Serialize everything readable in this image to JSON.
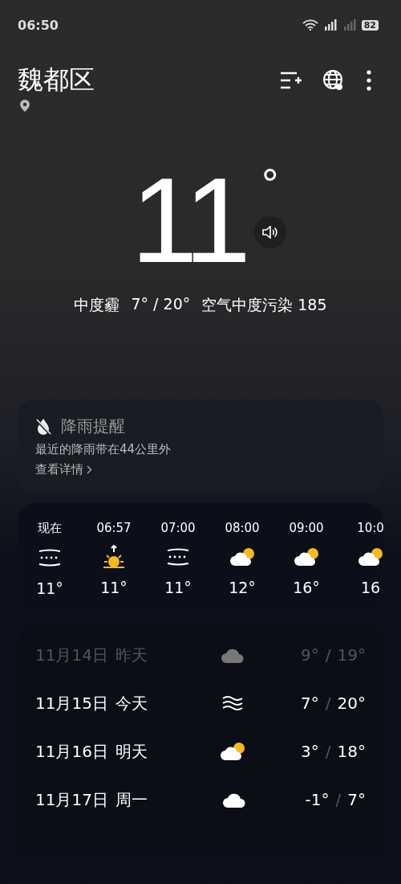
{
  "status_bar": {
    "time": "06:50",
    "battery": "82"
  },
  "header": {
    "location": "魏都区"
  },
  "current": {
    "temperature": "11",
    "degree": "°",
    "condition": "中度霾",
    "range": "7° / 20°",
    "air": "空气中度污染 185"
  },
  "rain_card": {
    "title": "降雨提醒",
    "text": "最近的降雨带在44公里外",
    "link": "查看详情"
  },
  "hourly": [
    {
      "time": "现在",
      "kind": "fog",
      "temp": "11°"
    },
    {
      "time": "06:57",
      "kind": "sunrise",
      "temp": "11°"
    },
    {
      "time": "07:00",
      "kind": "fog",
      "temp": "11°"
    },
    {
      "time": "08:00",
      "kind": "partly-cloudy",
      "temp": "12°"
    },
    {
      "time": "09:00",
      "kind": "partly-cloudy",
      "temp": "16°"
    },
    {
      "time": "10:0",
      "kind": "partly-cloudy",
      "temp": "16"
    }
  ],
  "daily": [
    {
      "date": "11月14日",
      "day": "昨天",
      "kind": "cloudy",
      "low": "9°",
      "separator": "/",
      "high": "19°",
      "past": true
    },
    {
      "date": "11月15日",
      "day": "今天",
      "kind": "haze",
      "low": "7°",
      "separator": "/",
      "high": "20°",
      "past": false
    },
    {
      "date": "11月16日",
      "day": "明天",
      "kind": "partly-cloudy",
      "low": "3°",
      "separator": "/",
      "high": "18°",
      "past": false
    },
    {
      "date": "11月17日",
      "day": "周一",
      "kind": "cloudy",
      "low": "-1°",
      "separator": "/",
      "high": "7°",
      "past": false
    }
  ]
}
